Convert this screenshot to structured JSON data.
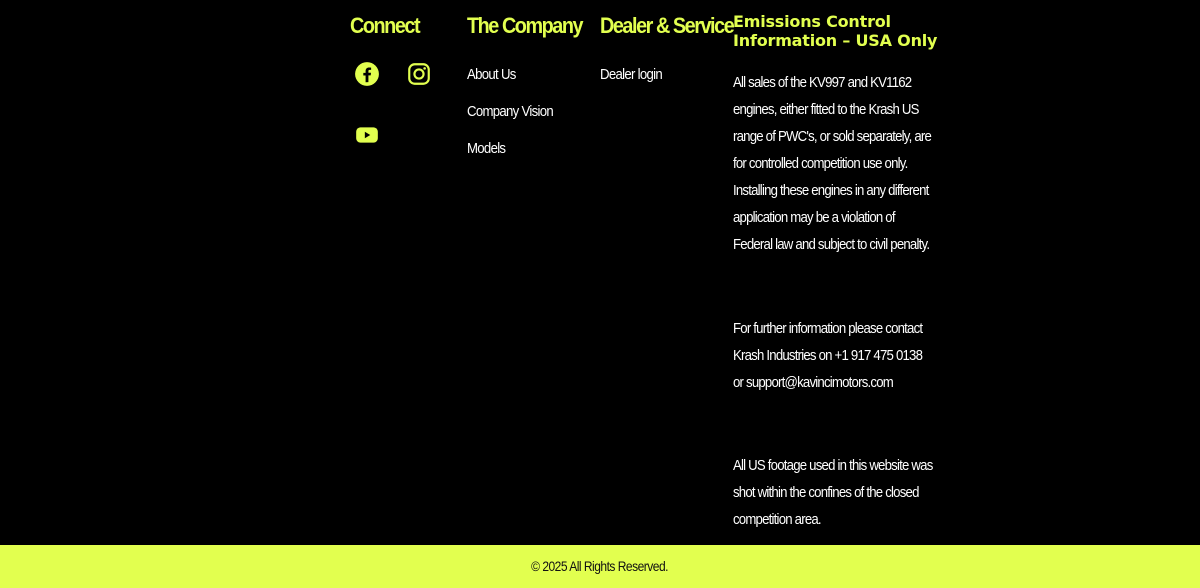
{
  "connect": {
    "heading": "Connect",
    "social": [
      {
        "name": "facebook-icon"
      },
      {
        "name": "instagram-icon"
      },
      {
        "name": "youtube-icon"
      }
    ]
  },
  "company": {
    "heading": "The Company",
    "links": [
      "About Us",
      "Company Vision",
      "Models"
    ]
  },
  "dealer": {
    "heading": "Dealer & Service",
    "links": [
      "Dealer login"
    ]
  },
  "emissions": {
    "title": "Emissions Control Information – USA Only",
    "paragraphs": [
      "All sales of the KV997 and KV1162 engines, either fitted to the Krash US range of PWC's, or sold separately, are for controlled competition use only. Installing these engines in any different application may be a violation of Federal law and subject to civil penalty.",
      "For further information please contact Krash Industries on +1 917 475 0138 or support@kavincimotors.com",
      "All US footage used in this website was shot within the confines of the closed competition area."
    ]
  },
  "footer": {
    "copyright": "© 2025 All Rights Reserved."
  },
  "colors": {
    "accent": "#e2ff4f",
    "background": "#000000",
    "text": "#ffffff"
  }
}
